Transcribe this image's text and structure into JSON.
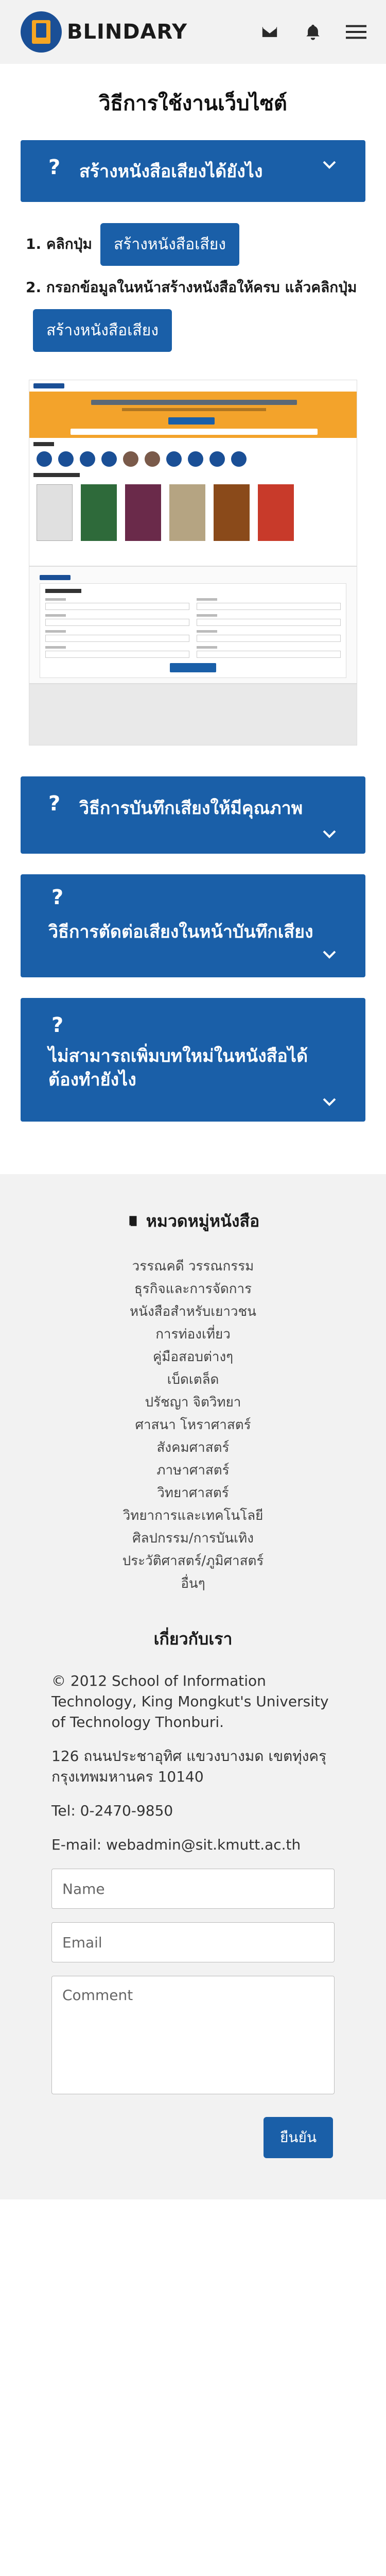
{
  "brand": {
    "name": "BLINDARY"
  },
  "nav": {
    "icons": [
      "mail-icon",
      "bell-icon",
      "menu-icon"
    ]
  },
  "page": {
    "title": "วิธีการใช้งานเว็บไซต์"
  },
  "faq": [
    {
      "q": "?",
      "label": "สร้างหนังสือเสียงได้ยังไง"
    },
    {
      "q": "?",
      "label": "วิธีการบันทึกเสียงให้มีคุณภาพ"
    },
    {
      "q": "?",
      "label": "วิธีการตัดต่อเสียงในหน้าบันทึกเสียง"
    },
    {
      "q": "?",
      "label": "ไม่สามารถเพิ่มบทใหม่ในหนังสือได้ต้องทำยังไง"
    }
  ],
  "steps": {
    "step1_prefix": "1. คลิกปุ่ม",
    "step1_button": "สร้างหนังสือเสียง",
    "step2_text": "2. กรอกข้อมูลในหน้าสร้างหนังสือให้ครบ แล้วคลิกปุ่ม",
    "step2_button": "สร้างหนังสือเสียง"
  },
  "footer": {
    "category_title": "หมวดหมู่หนังสือ",
    "categories": [
      "วรรณคดี วรรณกรรม",
      "ธุรกิจและการจัดการ",
      "หนังสือสำหรับเยาวชน",
      "การท่องเที่ยว",
      "คู่มือสอบต่างๆ",
      "เบ็ดเตล็ด",
      "ปรัชญา จิตวิทยา",
      "ศาสนา โหราศาสตร์",
      "สังคมศาสตร์",
      "ภาษาศาสตร์",
      "วิทยาศาสตร์",
      "วิทยาการและเทคโนโลยี",
      "ศิลปกรรม/การบันเทิง",
      "ประวัติศาสตร์/ภูมิศาสตร์",
      "อื่นๆ"
    ],
    "about_title": "เกี่ยวกับเรา",
    "about_copyright": "© 2012 School of Information Technology, King Mongkut's University of Technology Thonburi.",
    "about_address": "126 ถนนประชาอุทิศ แขวงบางมด เขตทุ่งครุ กรุงเทพมหานคร 10140",
    "about_tel": "Tel: 0-2470-9850",
    "about_email": "E-mail: webadmin@sit.kmutt.ac.th",
    "form": {
      "name_placeholder": "Name",
      "email_placeholder": "Email",
      "comment_placeholder": "Comment",
      "submit_label": "ยืนยัน"
    }
  }
}
